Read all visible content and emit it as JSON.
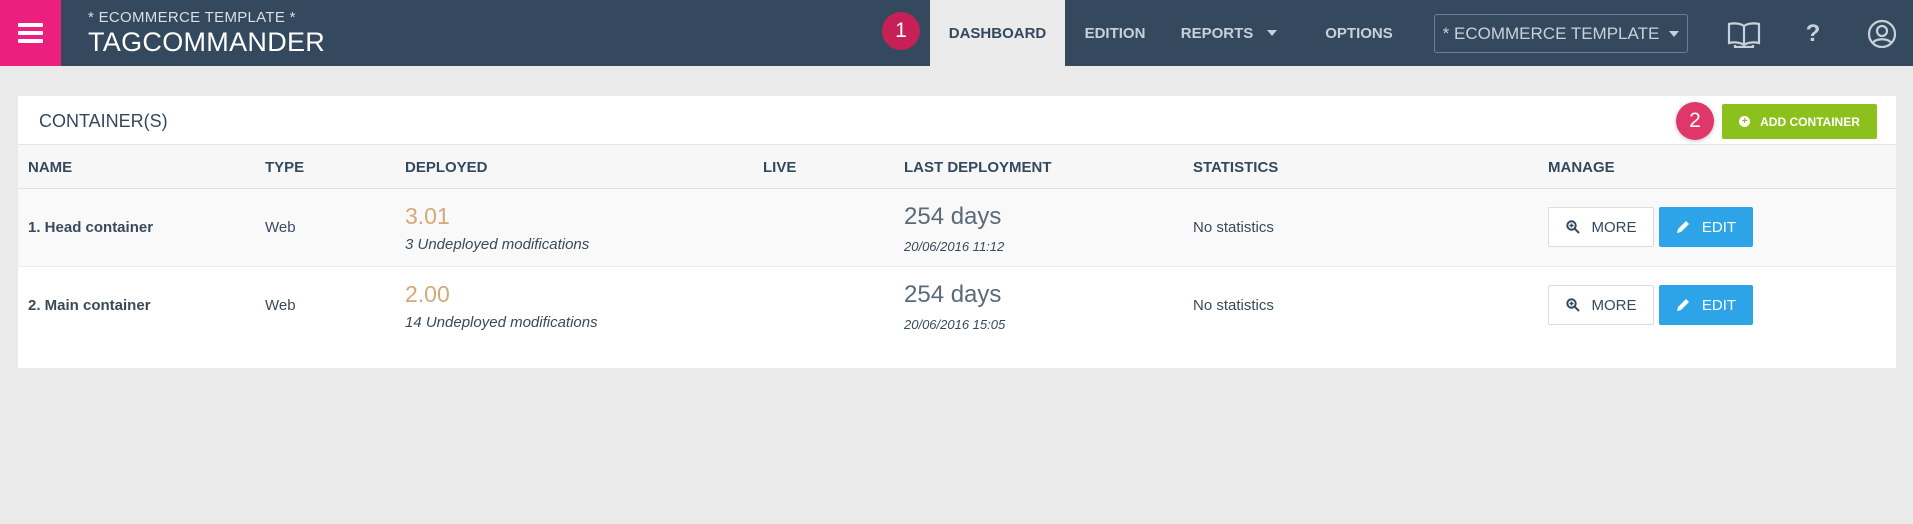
{
  "header": {
    "subtitle": "* ECOMMERCE TEMPLATE *",
    "title": "TAGCOMMANDER",
    "nav": [
      {
        "label": "DASHBOARD",
        "active": true
      },
      {
        "label": "EDITION",
        "active": false
      },
      {
        "label": "REPORTS",
        "active": false
      },
      {
        "label": "OPTIONS",
        "active": false
      }
    ],
    "site_selector": "* ECOMMERCE TEMPLATE",
    "help_label": "?",
    "icons": [
      "menu-icon",
      "book-icon",
      "help-icon",
      "user-icon"
    ]
  },
  "badges": {
    "first": "1",
    "second": "2"
  },
  "panel": {
    "title": "CONTAINER(S)",
    "add_button": "ADD CONTAINER",
    "columns": [
      "NAME",
      "TYPE",
      "DEPLOYED",
      "LIVE",
      "LAST DEPLOYMENT",
      "STATISTICS",
      "MANAGE"
    ],
    "rows": [
      {
        "name": "1. Head container",
        "type": "Web",
        "version": "3.01",
        "modifications": "3 Undeployed modifications",
        "last_deployment": "254 days",
        "deployment_date": "20/06/2016 11:12",
        "statistics": "No statistics",
        "more_label": "MORE",
        "edit_label": "EDIT"
      },
      {
        "name": "2. Main container",
        "type": "Web",
        "version": "2.00",
        "modifications": "14 Undeployed modifications",
        "last_deployment": "254 days",
        "deployment_date": "20/06/2016 15:05",
        "statistics": "No statistics",
        "more_label": "MORE",
        "edit_label": "EDIT"
      }
    ]
  },
  "colors": {
    "topbar": "#34495e",
    "menu_accent": "#ec1f7f",
    "add_button": "#8cc11d",
    "edit_button": "#2ea4e8",
    "version_text": "#d4a978",
    "badge": "#c62056"
  }
}
